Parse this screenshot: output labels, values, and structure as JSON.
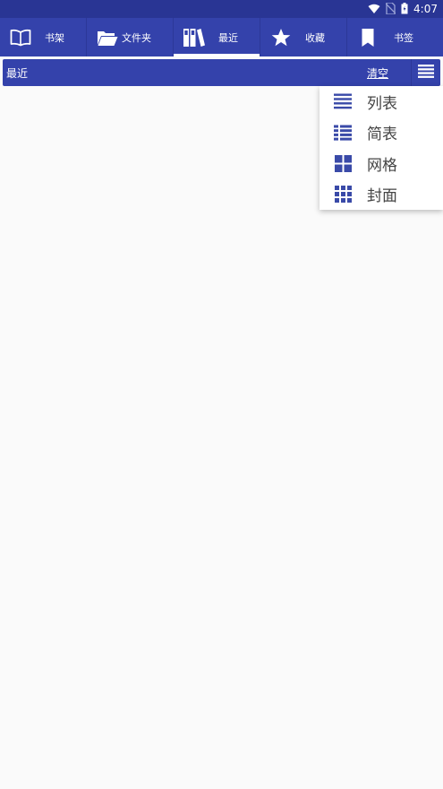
{
  "status": {
    "time": "4:07"
  },
  "tabs": [
    {
      "label": "书架",
      "icon": "book-open-icon"
    },
    {
      "label": "文件夹",
      "icon": "folder-icon"
    },
    {
      "label": "最近",
      "icon": "recent-books-icon",
      "active": true
    },
    {
      "label": "收藏",
      "icon": "star-icon"
    },
    {
      "label": "书签",
      "icon": "bookmark-icon"
    }
  ],
  "toolbar": {
    "title": "最近",
    "clear_label": "清空",
    "menu_icon": "menu-icon"
  },
  "view_menu": {
    "items": [
      {
        "label": "列表",
        "icon": "list-icon"
      },
      {
        "label": "简表",
        "icon": "compact-list-icon"
      },
      {
        "label": "网格",
        "icon": "grid-icon"
      },
      {
        "label": "封面",
        "icon": "cover-grid-icon"
      }
    ]
  },
  "colors": {
    "primary": "#3442ab",
    "status_bar": "#293594",
    "menu_icon": "#3a4aa8",
    "background": "#fafafa"
  }
}
